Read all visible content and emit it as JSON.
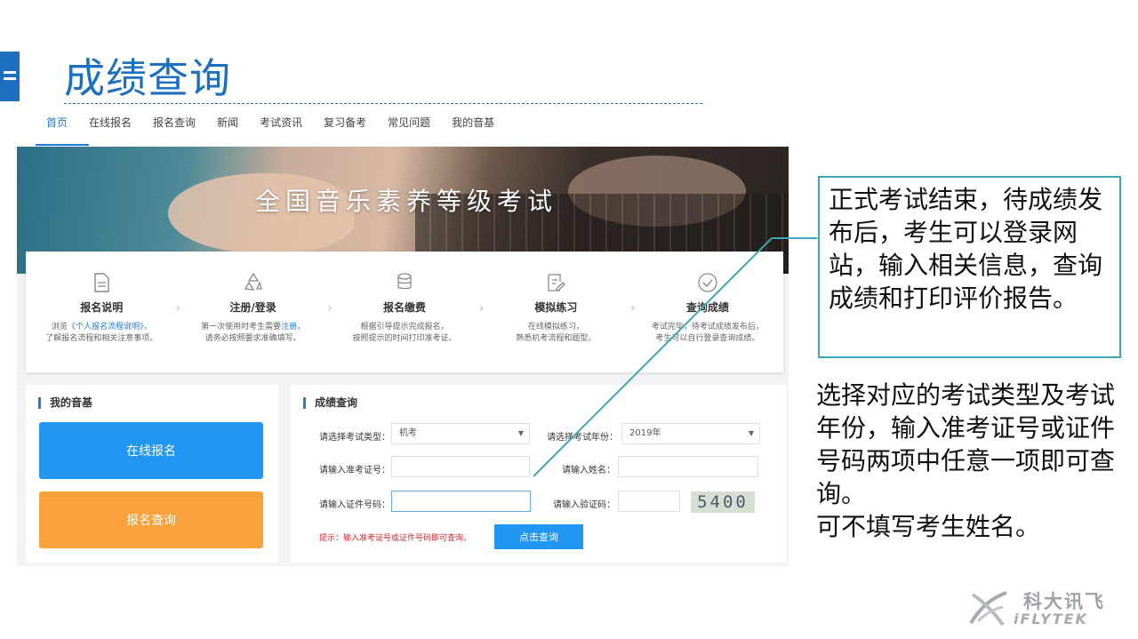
{
  "slide": {
    "title": "成绩查询",
    "callout_text": "正式考试结束，待成绩发布后，考生可以登录网站，输入相关信息，查询成绩和打印评价报告。",
    "note_line1": "选择对应的考试类型及考试年份，输入准考证号或证件号码两项中任意一项即可查询。",
    "note_line2": "可不填写考生姓名。",
    "accent_color": "#1d6fc0",
    "callout_border_color": "#3fa6b6"
  },
  "nav": {
    "items": [
      "首页",
      "在线报名",
      "报名查询",
      "新闻",
      "考试资讯",
      "复习备考",
      "常见问题",
      "我的音基"
    ],
    "active_index": 0
  },
  "banner": {
    "title": "全国音乐素养等级考试"
  },
  "steps": [
    {
      "icon": "document-icon",
      "name": "报名说明",
      "desc_prefix": "浏览",
      "desc_link": "《个人报名流程说明》",
      "desc_suffix": "，",
      "desc_line2": "了解报名流程和相关注意事项。"
    },
    {
      "icon": "recycle-icon",
      "name": "注册/登录",
      "desc_prefix": "第一次使用时考生需要",
      "desc_link": "注册",
      "desc_suffix": "，",
      "desc_line2": "请务必按照要求准确填写。"
    },
    {
      "icon": "coins-icon",
      "name": "报名缴费",
      "desc_prefix": "根据引导提示完成报名，",
      "desc_link": "",
      "desc_suffix": "",
      "desc_line2": "按照提示的时间打印准考证。"
    },
    {
      "icon": "edit-icon",
      "name": "模拟练习",
      "desc_prefix": "在线模拟练习，",
      "desc_link": "",
      "desc_suffix": "",
      "desc_line2": "熟悉机考流程和题型。"
    },
    {
      "icon": "check-circle-icon",
      "name": "查询成绩",
      "desc_prefix": "考试完毕，待考试成绩发布后，",
      "desc_link": "",
      "desc_suffix": "",
      "desc_line2": "考生可以自行登录查询成绩。"
    }
  ],
  "my_panel": {
    "heading": "我的音基",
    "signup_label": "在线报名",
    "query_label": "报名查询",
    "signup_color": "#2196f3",
    "query_color": "#f9a23b"
  },
  "score_form": {
    "heading": "成绩查询",
    "exam_type_label": "请选择考试类型：",
    "exam_type_value": "机考",
    "exam_year_label": "请选择考试年份：",
    "exam_year_value": "2019年",
    "ticket_label": "请输入准考证号：",
    "ticket_value": "",
    "name_label": "请输入姓名：",
    "name_value": "",
    "id_label": "请输入证件号码：",
    "id_value": "",
    "captcha_label": "请输入验证码：",
    "captcha_value": "",
    "captcha_text": "5400",
    "hint": "提示：输入准考证号或证件号码即可查询。",
    "submit_label": "点击查询"
  },
  "logo": {
    "cn": "科大讯飞",
    "en": "iFLYTEK"
  }
}
